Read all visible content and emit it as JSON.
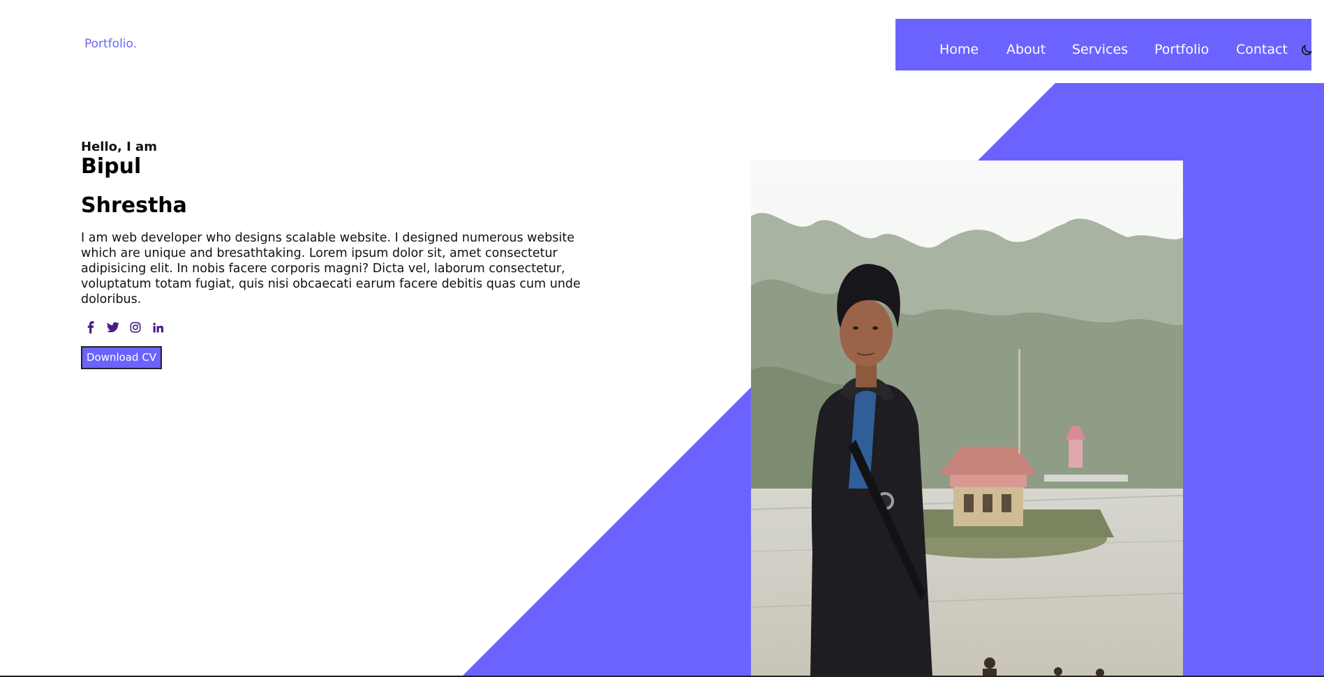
{
  "brand": {
    "logo_text": "Portfolio."
  },
  "nav": {
    "items": [
      {
        "label": "Home"
      },
      {
        "label": "About"
      },
      {
        "label": "Services"
      },
      {
        "label": "Portfolio"
      },
      {
        "label": "Contact"
      }
    ],
    "theme_toggle_icon": "moon-icon"
  },
  "hero": {
    "greeting": "Hello, I am",
    "first_name": "Bipul",
    "last_name": "Shrestha",
    "bio": "I am web developer who designs scalable website. I designed numerous website which are unique and bresathtaking. Lorem ipsum dolor sit, amet consectetur adipisicing elit. In nobis facere corporis magni? Dicta vel, laborum consectetur, voluptatum totam fugiat, quis nisi obcaecati earum facere debitis quas cum unde doloribus.",
    "socials": [
      {
        "icon": "facebook-icon"
      },
      {
        "icon": "twitter-icon"
      },
      {
        "icon": "instagram-icon"
      },
      {
        "icon": "linkedin-icon"
      }
    ],
    "cv_button_label": "Download CV"
  },
  "colors": {
    "accent": "#6c63ff",
    "social_icon": "#4b1a8a"
  }
}
